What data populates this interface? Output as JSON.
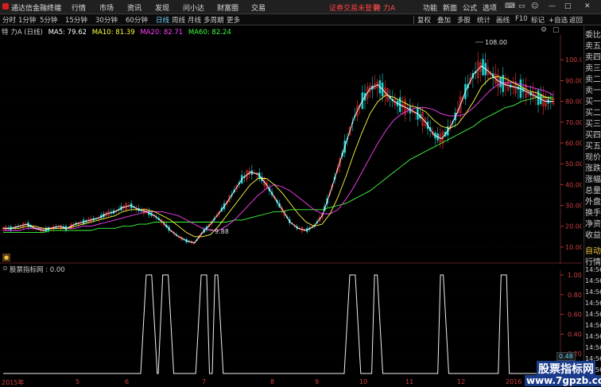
{
  "titlebar": {
    "app_title": "通达信金融终端",
    "menus": [
      "行情",
      "市场",
      "资讯",
      "发现",
      "问小达",
      "财富圈",
      "交易"
    ],
    "notice": "证券交易未登录",
    "stock_title": "特 力A",
    "right_menus": [
      "功能",
      "新面",
      "公式",
      "选项"
    ]
  },
  "toolbar": {
    "periods": [
      "分时",
      "1分钟",
      "5分钟",
      "15分钟",
      "30分钟",
      "60分钟",
      "日线",
      "周线",
      "月线",
      "多周期",
      "更多"
    ],
    "active_period": "日线",
    "right_tools": [
      "复权",
      "叠加",
      "多股",
      "统计",
      "画线",
      "F10",
      "标记",
      "+自选",
      "返回"
    ]
  },
  "info": {
    "name": "特 力A (日线)",
    "ma5": "MA5: 79.62",
    "ma10": "MA10: 81.39",
    "ma20": "MA20: 82.71",
    "ma60": "MA60: 82.24"
  },
  "colors": {
    "up": "#ff3030",
    "down": "#20d0d0",
    "ma5": "#ffffff",
    "ma10": "#ffff40",
    "ma20": "#ff40ff",
    "ma60": "#40ff40",
    "axis": "#d04040"
  },
  "main_axis": {
    "ticks": [
      "100.0",
      "90.00",
      "80.00",
      "70.00",
      "60.00",
      "50.00",
      "40.00",
      "30.00",
      "20.00",
      "10.00"
    ]
  },
  "annotations": {
    "high": "108.00",
    "low": "9.88"
  },
  "indicator": {
    "label": "股票指标网 : 0.00",
    "ticks": [
      "1.00",
      "0.80",
      "0.60",
      "0.40",
      "0.20"
    ],
    "current_value": "0.48"
  },
  "xaxis": {
    "labels": [
      "2015年",
      "5",
      "6",
      "7",
      "8",
      "9",
      "10",
      "11",
      "12",
      "2016"
    ]
  },
  "side_panel": {
    "items": [
      "委比",
      "卖五",
      "卖四",
      "卖三",
      "卖二",
      "卖一",
      "买一",
      "买二",
      "买三",
      "买四",
      "买五",
      "现价",
      "涨跌",
      "涨幅",
      "总量",
      "外盘",
      "换手",
      "净资",
      "收益"
    ],
    "lower_items": [
      "自动",
      "行情",
      "14:56",
      "14:56",
      "14:56",
      "14:56",
      "14:56",
      "14:56",
      "14:56",
      "14:56",
      "14:56",
      "14:56"
    ]
  },
  "watermark": {
    "text": "股票指标网",
    "url": "www.7gpzb.com"
  },
  "chart_data": {
    "type": "line",
    "title": "",
    "xlabel": "",
    "ylabel": "",
    "ylim": [
      5,
      110
    ],
    "ma5": [
      19,
      19,
      20,
      21,
      19,
      18,
      19,
      20,
      19,
      21,
      22,
      23,
      24,
      26,
      27,
      29,
      30,
      28,
      27,
      25,
      22,
      18,
      15,
      13,
      12,
      17,
      21,
      26,
      31,
      37,
      43,
      46,
      45,
      40,
      34,
      28,
      22,
      19,
      18,
      20,
      25,
      36,
      48,
      60,
      72,
      80,
      86,
      88,
      84,
      80,
      78,
      76,
      74,
      70,
      64,
      62,
      67,
      75,
      85,
      93,
      97,
      94,
      90,
      88,
      87,
      86,
      84,
      82,
      80,
      80
    ],
    "ma10": [
      19,
      19,
      19,
      20,
      20,
      19,
      19,
      19,
      19,
      20,
      21,
      22,
      23,
      24,
      25,
      27,
      28,
      28,
      28,
      27,
      25,
      23,
      20,
      17,
      15,
      15,
      16,
      20,
      25,
      30,
      35,
      40,
      43,
      43,
      40,
      36,
      31,
      26,
      22,
      20,
      21,
      26,
      34,
      44,
      55,
      65,
      74,
      80,
      83,
      82,
      80,
      78,
      77,
      75,
      71,
      68,
      67,
      69,
      74,
      80,
      87,
      91,
      92,
      91,
      89,
      87,
      85,
      84,
      82,
      81
    ],
    "ma20": [
      18,
      18,
      18,
      19,
      19,
      19,
      19,
      19,
      19,
      19,
      20,
      20,
      21,
      22,
      23,
      24,
      25,
      26,
      27,
      27,
      27,
      26,
      25,
      23,
      21,
      19,
      18,
      18,
      20,
      23,
      27,
      31,
      35,
      38,
      40,
      39,
      37,
      34,
      31,
      28,
      26,
      26,
      28,
      33,
      39,
      46,
      53,
      60,
      66,
      71,
      74,
      76,
      77,
      77,
      76,
      74,
      73,
      73,
      74,
      77,
      81,
      85,
      88,
      89,
      89,
      88,
      87,
      86,
      85,
      83
    ],
    "ma60": [
      17,
      17,
      17,
      17,
      17,
      17,
      18,
      18,
      18,
      18,
      18,
      18,
      19,
      19,
      19,
      20,
      20,
      21,
      21,
      22,
      22,
      22,
      22,
      22,
      22,
      22,
      22,
      22,
      22,
      23,
      23,
      24,
      25,
      26,
      27,
      27,
      28,
      28,
      28,
      28,
      28,
      29,
      30,
      31,
      33,
      35,
      37,
      40,
      43,
      46,
      49,
      52,
      54,
      56,
      58,
      60,
      62,
      64,
      66,
      68,
      71,
      73,
      75,
      77,
      78,
      80,
      81,
      82,
      82,
      82
    ],
    "signal": [
      [
        0,
        0
      ],
      [
        0.25,
        0
      ],
      [
        0.26,
        1
      ],
      [
        0.27,
        1
      ],
      [
        0.28,
        0
      ],
      [
        0.282,
        0
      ],
      [
        0.29,
        1
      ],
      [
        0.3,
        1
      ],
      [
        0.31,
        0
      ],
      [
        0.35,
        0
      ],
      [
        0.36,
        1
      ],
      [
        0.37,
        1
      ],
      [
        0.375,
        0
      ],
      [
        0.38,
        0
      ],
      [
        0.385,
        1
      ],
      [
        0.39,
        1
      ],
      [
        0.4,
        0
      ],
      [
        0.62,
        0
      ],
      [
        0.63,
        1
      ],
      [
        0.64,
        1
      ],
      [
        0.65,
        0
      ],
      [
        0.67,
        0
      ],
      [
        0.675,
        1
      ],
      [
        0.68,
        1
      ],
      [
        0.69,
        0
      ],
      [
        0.79,
        0
      ],
      [
        0.795,
        1
      ],
      [
        0.8,
        1
      ],
      [
        0.81,
        0
      ],
      [
        0.9,
        0
      ],
      [
        0.905,
        1
      ],
      [
        0.915,
        1
      ],
      [
        0.92,
        0
      ],
      [
        1,
        0
      ]
    ]
  }
}
